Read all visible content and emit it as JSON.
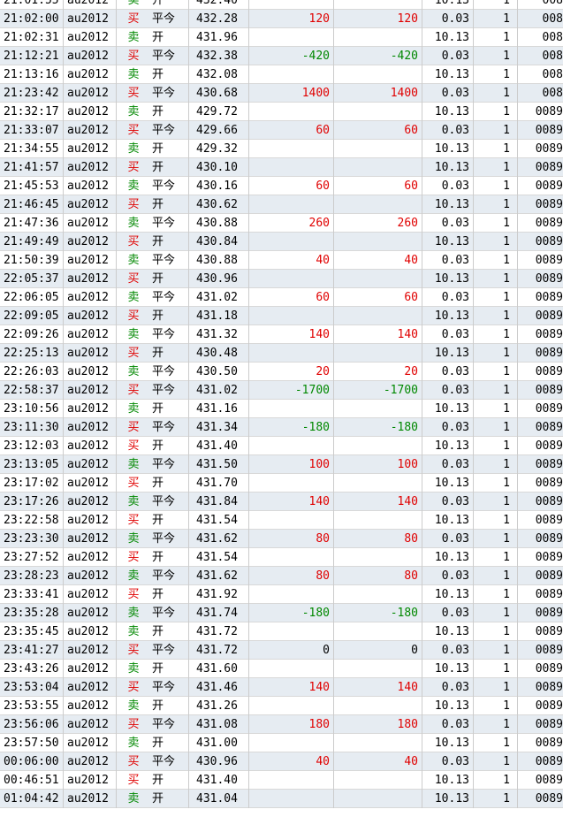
{
  "colors": {
    "buy": "#e00000",
    "sell": "#008800",
    "alt_row": "#e6ecf2"
  },
  "rows": [
    {
      "time": "21:01:55",
      "symbol": "au2012",
      "direction": "卖",
      "openclose": "开",
      "price": "432.40",
      "pnl": "",
      "pnl2": "",
      "fee": "10.13",
      "qty": "1",
      "order": "008"
    },
    {
      "time": "21:02:00",
      "symbol": "au2012",
      "direction": "买",
      "openclose": "平今",
      "price": "432.28",
      "pnl": "120",
      "pnl2": "120",
      "fee": "0.03",
      "qty": "1",
      "order": "008"
    },
    {
      "time": "21:02:31",
      "symbol": "au2012",
      "direction": "卖",
      "openclose": "开",
      "price": "431.96",
      "pnl": "",
      "pnl2": "",
      "fee": "10.13",
      "qty": "1",
      "order": "008"
    },
    {
      "time": "21:12:21",
      "symbol": "au2012",
      "direction": "买",
      "openclose": "平今",
      "price": "432.38",
      "pnl": "-420",
      "pnl2": "-420",
      "fee": "0.03",
      "qty": "1",
      "order": "008"
    },
    {
      "time": "21:13:16",
      "symbol": "au2012",
      "direction": "卖",
      "openclose": "开",
      "price": "432.08",
      "pnl": "",
      "pnl2": "",
      "fee": "10.13",
      "qty": "1",
      "order": "008"
    },
    {
      "time": "21:23:42",
      "symbol": "au2012",
      "direction": "买",
      "openclose": "平今",
      "price": "430.68",
      "pnl": "1400",
      "pnl2": "1400",
      "fee": "0.03",
      "qty": "1",
      "order": "008"
    },
    {
      "time": "21:32:17",
      "symbol": "au2012",
      "direction": "卖",
      "openclose": "开",
      "price": "429.72",
      "pnl": "",
      "pnl2": "",
      "fee": "10.13",
      "qty": "1",
      "order": "0089"
    },
    {
      "time": "21:33:07",
      "symbol": "au2012",
      "direction": "买",
      "openclose": "平今",
      "price": "429.66",
      "pnl": "60",
      "pnl2": "60",
      "fee": "0.03",
      "qty": "1",
      "order": "0089"
    },
    {
      "time": "21:34:55",
      "symbol": "au2012",
      "direction": "卖",
      "openclose": "开",
      "price": "429.32",
      "pnl": "",
      "pnl2": "",
      "fee": "10.13",
      "qty": "1",
      "order": "0089"
    },
    {
      "time": "21:41:57",
      "symbol": "au2012",
      "direction": "买",
      "openclose": "开",
      "price": "430.10",
      "pnl": "",
      "pnl2": "",
      "fee": "10.13",
      "qty": "1",
      "order": "0089"
    },
    {
      "time": "21:45:53",
      "symbol": "au2012",
      "direction": "卖",
      "openclose": "平今",
      "price": "430.16",
      "pnl": "60",
      "pnl2": "60",
      "fee": "0.03",
      "qty": "1",
      "order": "0089"
    },
    {
      "time": "21:46:45",
      "symbol": "au2012",
      "direction": "买",
      "openclose": "开",
      "price": "430.62",
      "pnl": "",
      "pnl2": "",
      "fee": "10.13",
      "qty": "1",
      "order": "0089"
    },
    {
      "time": "21:47:36",
      "symbol": "au2012",
      "direction": "卖",
      "openclose": "平今",
      "price": "430.88",
      "pnl": "260",
      "pnl2": "260",
      "fee": "0.03",
      "qty": "1",
      "order": "0089"
    },
    {
      "time": "21:49:49",
      "symbol": "au2012",
      "direction": "买",
      "openclose": "开",
      "price": "430.84",
      "pnl": "",
      "pnl2": "",
      "fee": "10.13",
      "qty": "1",
      "order": "0089"
    },
    {
      "time": "21:50:39",
      "symbol": "au2012",
      "direction": "卖",
      "openclose": "平今",
      "price": "430.88",
      "pnl": "40",
      "pnl2": "40",
      "fee": "0.03",
      "qty": "1",
      "order": "0089"
    },
    {
      "time": "22:05:37",
      "symbol": "au2012",
      "direction": "买",
      "openclose": "开",
      "price": "430.96",
      "pnl": "",
      "pnl2": "",
      "fee": "10.13",
      "qty": "1",
      "order": "0089"
    },
    {
      "time": "22:06:05",
      "symbol": "au2012",
      "direction": "卖",
      "openclose": "平今",
      "price": "431.02",
      "pnl": "60",
      "pnl2": "60",
      "fee": "0.03",
      "qty": "1",
      "order": "0089"
    },
    {
      "time": "22:09:05",
      "symbol": "au2012",
      "direction": "买",
      "openclose": "开",
      "price": "431.18",
      "pnl": "",
      "pnl2": "",
      "fee": "10.13",
      "qty": "1",
      "order": "0089"
    },
    {
      "time": "22:09:26",
      "symbol": "au2012",
      "direction": "卖",
      "openclose": "平今",
      "price": "431.32",
      "pnl": "140",
      "pnl2": "140",
      "fee": "0.03",
      "qty": "1",
      "order": "0089"
    },
    {
      "time": "22:25:13",
      "symbol": "au2012",
      "direction": "买",
      "openclose": "开",
      "price": "430.48",
      "pnl": "",
      "pnl2": "",
      "fee": "10.13",
      "qty": "1",
      "order": "0089"
    },
    {
      "time": "22:26:03",
      "symbol": "au2012",
      "direction": "卖",
      "openclose": "平今",
      "price": "430.50",
      "pnl": "20",
      "pnl2": "20",
      "fee": "0.03",
      "qty": "1",
      "order": "0089"
    },
    {
      "time": "22:58:37",
      "symbol": "au2012",
      "direction": "买",
      "openclose": "平今",
      "price": "431.02",
      "pnl": "-1700",
      "pnl2": "-1700",
      "fee": "0.03",
      "qty": "1",
      "order": "0089"
    },
    {
      "time": "23:10:56",
      "symbol": "au2012",
      "direction": "卖",
      "openclose": "开",
      "price": "431.16",
      "pnl": "",
      "pnl2": "",
      "fee": "10.13",
      "qty": "1",
      "order": "0089"
    },
    {
      "time": "23:11:30",
      "symbol": "au2012",
      "direction": "买",
      "openclose": "平今",
      "price": "431.34",
      "pnl": "-180",
      "pnl2": "-180",
      "fee": "0.03",
      "qty": "1",
      "order": "0089"
    },
    {
      "time": "23:12:03",
      "symbol": "au2012",
      "direction": "买",
      "openclose": "开",
      "price": "431.40",
      "pnl": "",
      "pnl2": "",
      "fee": "10.13",
      "qty": "1",
      "order": "0089"
    },
    {
      "time": "23:13:05",
      "symbol": "au2012",
      "direction": "卖",
      "openclose": "平今",
      "price": "431.50",
      "pnl": "100",
      "pnl2": "100",
      "fee": "0.03",
      "qty": "1",
      "order": "0089"
    },
    {
      "time": "23:17:02",
      "symbol": "au2012",
      "direction": "买",
      "openclose": "开",
      "price": "431.70",
      "pnl": "",
      "pnl2": "",
      "fee": "10.13",
      "qty": "1",
      "order": "0089"
    },
    {
      "time": "23:17:26",
      "symbol": "au2012",
      "direction": "卖",
      "openclose": "平今",
      "price": "431.84",
      "pnl": "140",
      "pnl2": "140",
      "fee": "0.03",
      "qty": "1",
      "order": "0089"
    },
    {
      "time": "23:22:58",
      "symbol": "au2012",
      "direction": "买",
      "openclose": "开",
      "price": "431.54",
      "pnl": "",
      "pnl2": "",
      "fee": "10.13",
      "qty": "1",
      "order": "0089"
    },
    {
      "time": "23:23:30",
      "symbol": "au2012",
      "direction": "卖",
      "openclose": "平今",
      "price": "431.62",
      "pnl": "80",
      "pnl2": "80",
      "fee": "0.03",
      "qty": "1",
      "order": "0089"
    },
    {
      "time": "23:27:52",
      "symbol": "au2012",
      "direction": "买",
      "openclose": "开",
      "price": "431.54",
      "pnl": "",
      "pnl2": "",
      "fee": "10.13",
      "qty": "1",
      "order": "0089"
    },
    {
      "time": "23:28:23",
      "symbol": "au2012",
      "direction": "卖",
      "openclose": "平今",
      "price": "431.62",
      "pnl": "80",
      "pnl2": "80",
      "fee": "0.03",
      "qty": "1",
      "order": "0089"
    },
    {
      "time": "23:33:41",
      "symbol": "au2012",
      "direction": "买",
      "openclose": "开",
      "price": "431.92",
      "pnl": "",
      "pnl2": "",
      "fee": "10.13",
      "qty": "1",
      "order": "0089"
    },
    {
      "time": "23:35:28",
      "symbol": "au2012",
      "direction": "卖",
      "openclose": "平今",
      "price": "431.74",
      "pnl": "-180",
      "pnl2": "-180",
      "fee": "0.03",
      "qty": "1",
      "order": "0089"
    },
    {
      "time": "23:35:45",
      "symbol": "au2012",
      "direction": "卖",
      "openclose": "开",
      "price": "431.72",
      "pnl": "",
      "pnl2": "",
      "fee": "10.13",
      "qty": "1",
      "order": "0089"
    },
    {
      "time": "23:41:27",
      "symbol": "au2012",
      "direction": "买",
      "openclose": "平今",
      "price": "431.72",
      "pnl": "0",
      "pnl2": "0",
      "fee": "0.03",
      "qty": "1",
      "order": "0089"
    },
    {
      "time": "23:43:26",
      "symbol": "au2012",
      "direction": "卖",
      "openclose": "开",
      "price": "431.60",
      "pnl": "",
      "pnl2": "",
      "fee": "10.13",
      "qty": "1",
      "order": "0089"
    },
    {
      "time": "23:53:04",
      "symbol": "au2012",
      "direction": "买",
      "openclose": "平今",
      "price": "431.46",
      "pnl": "140",
      "pnl2": "140",
      "fee": "0.03",
      "qty": "1",
      "order": "0089"
    },
    {
      "time": "23:53:55",
      "symbol": "au2012",
      "direction": "卖",
      "openclose": "开",
      "price": "431.26",
      "pnl": "",
      "pnl2": "",
      "fee": "10.13",
      "qty": "1",
      "order": "0089"
    },
    {
      "time": "23:56:06",
      "symbol": "au2012",
      "direction": "买",
      "openclose": "平今",
      "price": "431.08",
      "pnl": "180",
      "pnl2": "180",
      "fee": "0.03",
      "qty": "1",
      "order": "0089"
    },
    {
      "time": "23:57:50",
      "symbol": "au2012",
      "direction": "卖",
      "openclose": "开",
      "price": "431.00",
      "pnl": "",
      "pnl2": "",
      "fee": "10.13",
      "qty": "1",
      "order": "0089"
    },
    {
      "time": "00:06:00",
      "symbol": "au2012",
      "direction": "买",
      "openclose": "平今",
      "price": "430.96",
      "pnl": "40",
      "pnl2": "40",
      "fee": "0.03",
      "qty": "1",
      "order": "0089"
    },
    {
      "time": "00:46:51",
      "symbol": "au2012",
      "direction": "买",
      "openclose": "开",
      "price": "431.40",
      "pnl": "",
      "pnl2": "",
      "fee": "10.13",
      "qty": "1",
      "order": "0089"
    },
    {
      "time": "01:04:42",
      "symbol": "au2012",
      "direction": "卖",
      "openclose": "开",
      "price": "431.04",
      "pnl": "",
      "pnl2": "",
      "fee": "10.13",
      "qty": "1",
      "order": "0089"
    }
  ]
}
